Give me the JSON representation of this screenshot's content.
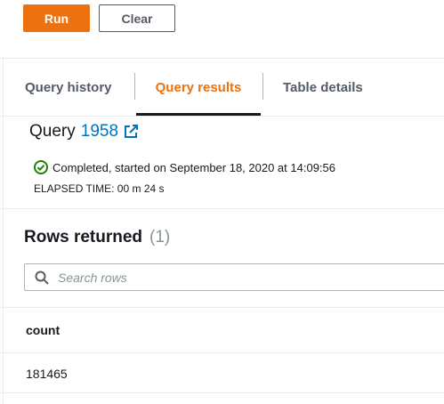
{
  "toolbar": {
    "run_label": "Run",
    "clear_label": "Clear"
  },
  "tabs": [
    {
      "label": "Query history"
    },
    {
      "label": "Query results",
      "active": true
    },
    {
      "label": "Table details"
    }
  ],
  "query": {
    "prefix": "Query",
    "id": "1958",
    "status": "Completed, started on September 18, 2020 at 14:09:56",
    "elapsed": "ELAPSED TIME: 00 m 24 s"
  },
  "results": {
    "title": "Rows returned",
    "count": "(1)",
    "search_placeholder": "Search rows",
    "columns": [
      "count"
    ],
    "rows": [
      [
        "181465"
      ]
    ]
  },
  "colors": {
    "accent": "#ec7211",
    "link": "#0073bb",
    "success": "#1d8102"
  },
  "icons": [
    "external-link-icon",
    "check-circle-icon",
    "search-icon"
  ]
}
